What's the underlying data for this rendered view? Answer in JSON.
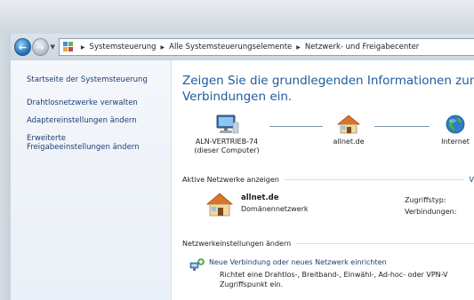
{
  "window": {
    "breadcrumb": [
      "Systemsteuerung",
      "Alle Systemsteuerungselemente",
      "Netzwerk- und Freigabecenter"
    ],
    "icons": {
      "back": "back-arrow-icon",
      "forward": "forward-arrow-icon",
      "recent": "dropdown-arrow-icon",
      "location": "control-panel-icon"
    }
  },
  "sidebar": {
    "home_link": "Startseite der Systemsteuerung",
    "links": [
      "Drahtlosnetzwerke verwalten",
      "Adaptereinstellungen ändern",
      "Erweiterte\nFreigabeeinstellungen ändern"
    ]
  },
  "main": {
    "heading_line1": "Zeigen Sie die grundlegenden Informationen zum Netzwe",
    "heading_line2": "Verbindungen ein.",
    "map": {
      "computer_name": "ALN-VERTRIEB-74",
      "computer_sub": "(dieser Computer)",
      "network_name": "allnet.de",
      "internet_label": "Internet"
    },
    "active_section": {
      "title": "Aktive Netzwerke anzeigen",
      "link_fragment": "V"
    },
    "active_network": {
      "name": "allnet.de",
      "type": "Domänennetzwerk",
      "access_label": "Zugriffstyp:",
      "connections_label": "Verbindungen:"
    },
    "settings_section": {
      "title": "Netzwerkeinstellungen ändern"
    },
    "task": {
      "link": "Neue Verbindung oder neues Netzwerk einrichten",
      "description_line1": "Richtet eine Drahtlos-, Breitband-, Einwähl-, Ad-hoc- oder VPN-V",
      "description_line2": "Zugriffspunkt ein."
    }
  },
  "colors": {
    "link": "#1a3f73",
    "heading": "#1e5a9e",
    "sidebar_bg": "#eef3f9",
    "frame": "#d9e0e7"
  }
}
